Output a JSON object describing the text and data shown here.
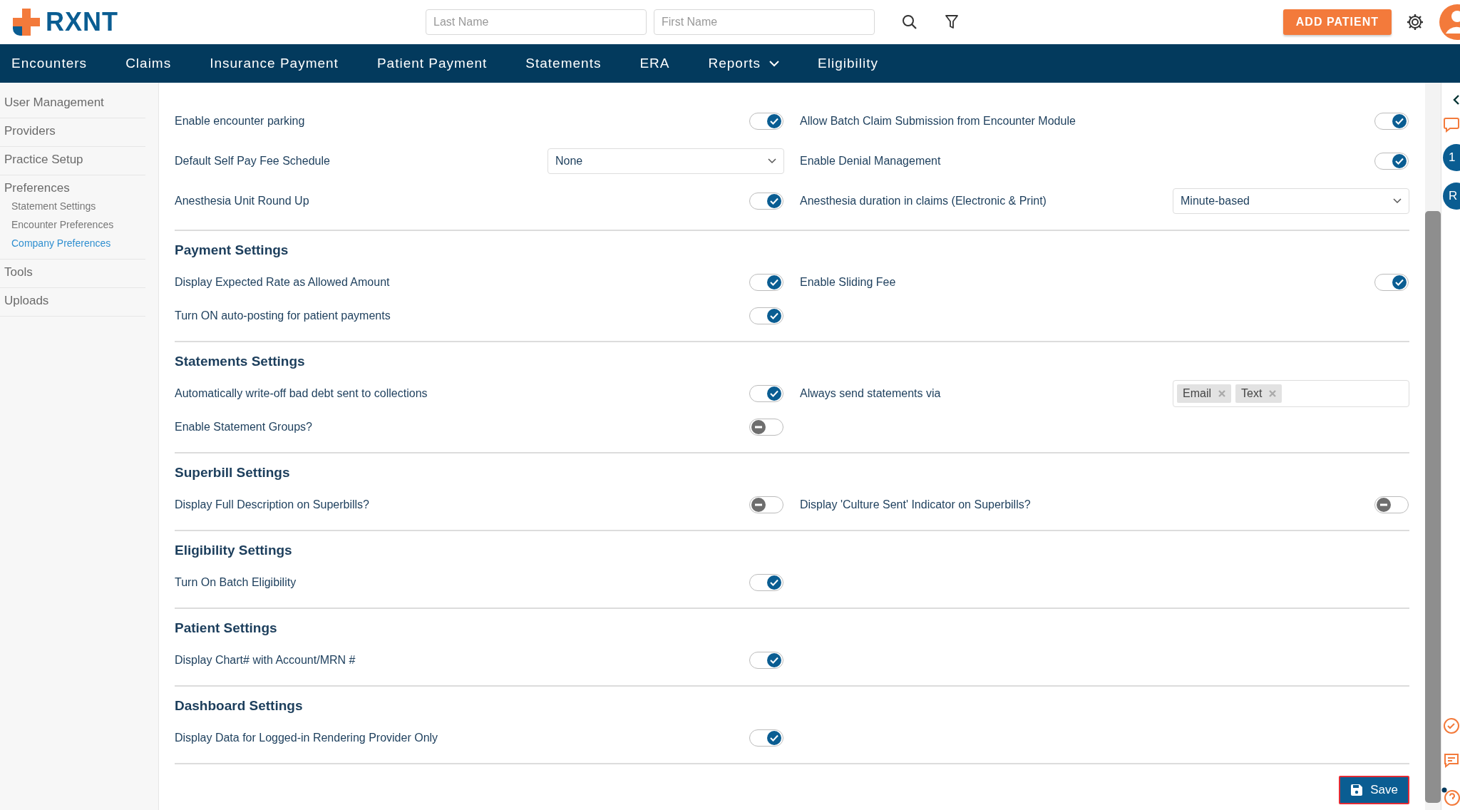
{
  "header": {
    "logo": "RXNT",
    "last_name": {
      "placeholder": "Last Name"
    },
    "first_name": {
      "placeholder": "First Name"
    },
    "add_button": "ADD PATIENT"
  },
  "nav": [
    {
      "label": "Encounters",
      "dropdown": false
    },
    {
      "label": "Claims",
      "dropdown": false
    },
    {
      "label": "Insurance Payment",
      "dropdown": false
    },
    {
      "label": "Patient Payment",
      "dropdown": false
    },
    {
      "label": "Statements",
      "dropdown": false
    },
    {
      "label": "ERA",
      "dropdown": false
    },
    {
      "label": "Reports",
      "dropdown": true
    },
    {
      "label": "Eligibility",
      "dropdown": false
    }
  ],
  "sidebar": [
    {
      "label": "User Management"
    },
    {
      "label": "Providers"
    },
    {
      "label": "Practice Setup"
    },
    {
      "label": "Preferences",
      "children": [
        {
          "label": "Statement Settings",
          "selected": false
        },
        {
          "label": "Encounter Preferences",
          "selected": false
        },
        {
          "label": "Company Preferences",
          "selected": true
        }
      ]
    },
    {
      "label": "Tools"
    },
    {
      "label": "Uploads"
    }
  ],
  "sections": [
    {
      "rows": [
        [
          {
            "label": "Enable encounter parking",
            "kind": "toggle",
            "on": true
          },
          {
            "label": "Allow Batch Claim Submission from Encounter Module",
            "kind": "toggle",
            "on": true
          }
        ],
        [
          {
            "label": "Default Self Pay Fee Schedule",
            "kind": "select",
            "value": "None"
          },
          {
            "label": "Enable Denial Management",
            "kind": "toggle",
            "on": true
          }
        ],
        [
          {
            "label": "Anesthesia Unit Round Up",
            "kind": "toggle",
            "on": true
          },
          {
            "label": "Anesthesia duration in claims (Electronic & Print)",
            "kind": "select",
            "value": "Minute-based"
          }
        ]
      ]
    },
    {
      "title": "Payment Settings",
      "rows": [
        [
          {
            "label": "Display Expected Rate as Allowed Amount",
            "kind": "toggle",
            "on": true
          },
          {
            "label": "Enable Sliding Fee",
            "kind": "toggle",
            "on": true
          }
        ],
        [
          {
            "label": "Turn ON auto-posting for patient payments",
            "kind": "toggle",
            "on": true
          }
        ]
      ]
    },
    {
      "title": "Statements Settings",
      "rows": [
        [
          {
            "label": "Automatically write-off bad debt sent to collections",
            "kind": "toggle",
            "on": true
          },
          {
            "label": "Always send statements via",
            "kind": "tags",
            "tags": [
              "Email",
              "Text"
            ]
          }
        ],
        [
          {
            "label": "Enable Statement Groups?",
            "kind": "toggle",
            "on": false
          }
        ]
      ]
    },
    {
      "title": "Superbill Settings",
      "rows": [
        [
          {
            "label": "Display Full Description on Superbills?",
            "kind": "toggle",
            "on": false
          },
          {
            "label": "Display 'Culture Sent' Indicator on Superbills?",
            "kind": "toggle",
            "on": false
          }
        ]
      ]
    },
    {
      "title": "Eligibility Settings",
      "rows": [
        [
          {
            "label": "Turn On Batch Eligibility",
            "kind": "toggle",
            "on": true
          }
        ]
      ]
    },
    {
      "title": "Patient Settings",
      "rows": [
        [
          {
            "label": "Display Chart# with Account/MRN #",
            "kind": "toggle",
            "on": true
          }
        ]
      ]
    },
    {
      "title": "Dashboard Settings",
      "rows": [
        [
          {
            "label": "Display Data for Logged-in Rendering Provider Only",
            "kind": "toggle",
            "on": true
          }
        ]
      ]
    }
  ],
  "save_button": "Save",
  "right_panel": {
    "badges": [
      "1",
      "R"
    ]
  }
}
